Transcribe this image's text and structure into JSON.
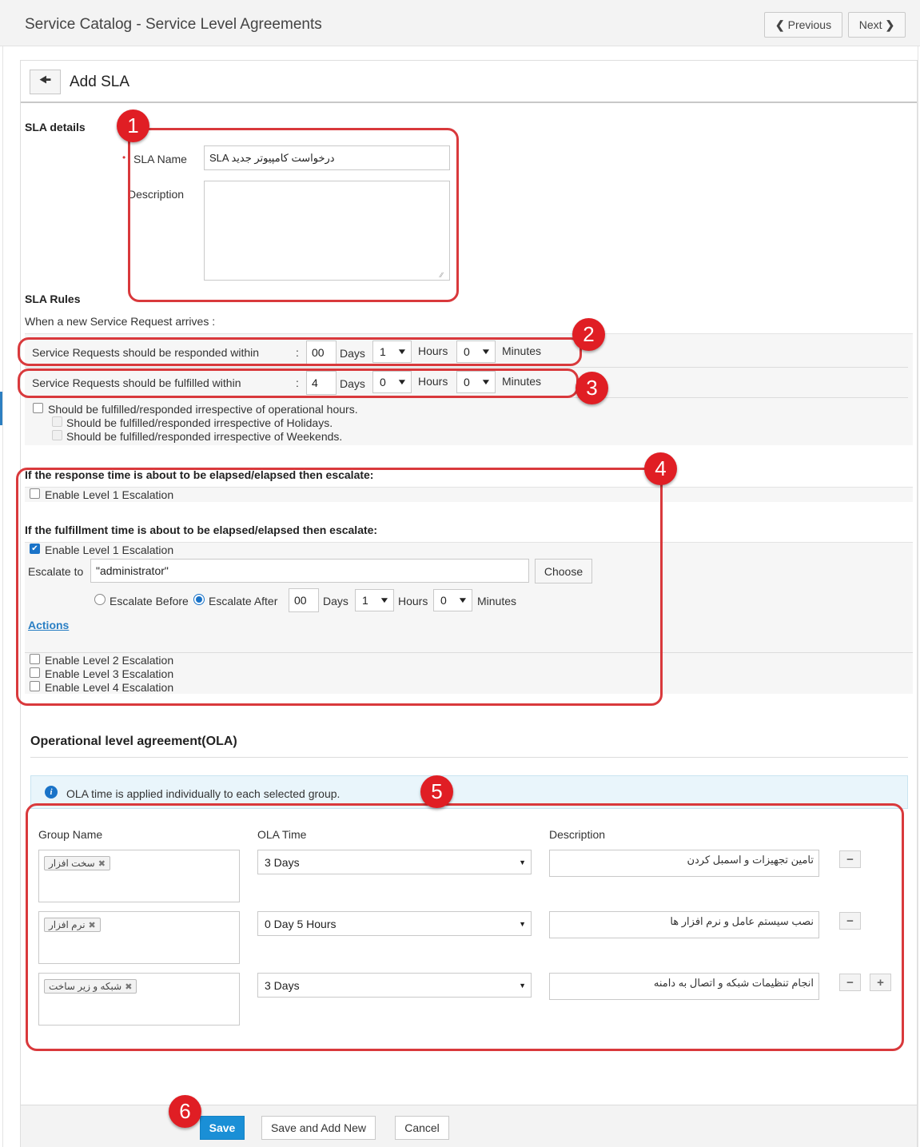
{
  "header": {
    "title": "Service Catalog - Service Level Agreements",
    "previous_label": "Previous",
    "next_label": "Next"
  },
  "panel": {
    "title": "Add SLA"
  },
  "sla_details": {
    "section_title": "SLA details",
    "name_label": "SLA Name",
    "name_value": "SLA درخواست کامپیوتر جدید",
    "description_label": "Description",
    "description_value": ""
  },
  "sla_rules": {
    "section_title": "SLA Rules",
    "intro": "When a new Service Request arrives :",
    "response": {
      "label": "Service Requests should be responded within",
      "colon": ":",
      "days": "00",
      "days_label": "Days",
      "hours": "1",
      "hours_label": "Hours",
      "minutes": "0",
      "minutes_label": "Minutes"
    },
    "fulfill": {
      "label": "Service Requests should be fulfilled within",
      "colon": ":",
      "days": "4",
      "days_label": "Days",
      "hours": "0",
      "hours_label": "Hours",
      "minutes": "0",
      "minutes_label": "Minutes"
    },
    "operational_hours_label": "Should be fulfilled/responded irrespective of operational hours.",
    "holidays_label": "Should be fulfilled/responded irrespective of Holidays.",
    "weekends_label": "Should be fulfilled/responded irrespective of Weekends."
  },
  "escalation": {
    "response_title": "If the response time is about to be elapsed/elapsed then escalate:",
    "response_level1_label": "Enable Level 1 Escalation",
    "fulfill_title": "If the fulfillment time is about to be elapsed/elapsed then escalate:",
    "fulfill_level1_label": "Enable Level 1 Escalation",
    "escalate_to_label": "Escalate to",
    "escalate_to_value": "\"administrator\"",
    "choose_label": "Choose",
    "before_label": "Escalate Before",
    "after_label": "Escalate After",
    "days": "00",
    "days_label": "Days",
    "hours": "1",
    "hours_label": "Hours",
    "minutes": "0",
    "minutes_label": "Minutes",
    "actions_label": "Actions",
    "level2_label": "Enable Level 2 Escalation",
    "level3_label": "Enable Level 3 Escalation",
    "level4_label": "Enable Level 4 Escalation"
  },
  "ola": {
    "title": "Operational level agreement(OLA)",
    "info": "OLA time is applied individually to each selected group.",
    "col_group": "Group Name",
    "col_time": "OLA Time",
    "col_description": "Description",
    "rows": [
      {
        "group": "سخت افزار",
        "time": "3 Days",
        "description": "تامین تجهیزات و اسمبل کردن"
      },
      {
        "group": "نرم افزار",
        "time": "0 Day 5 Hours",
        "description": "نصب سیستم عامل و نرم افزار ها"
      },
      {
        "group": "شبکه و زیر ساخت",
        "time": "3 Days",
        "description": "انجام تنظیمات شبکه و اتصال به دامنه"
      }
    ]
  },
  "footer": {
    "save_label": "Save",
    "save_add_new_label": "Save and Add New",
    "cancel_label": "Cancel"
  },
  "callouts": [
    "1",
    "2",
    "3",
    "4",
    "5",
    "6"
  ],
  "colors": {
    "callout_red": "#e01e24",
    "primary_blue": "#1a8fd6",
    "link_blue": "#2a7fc4"
  }
}
